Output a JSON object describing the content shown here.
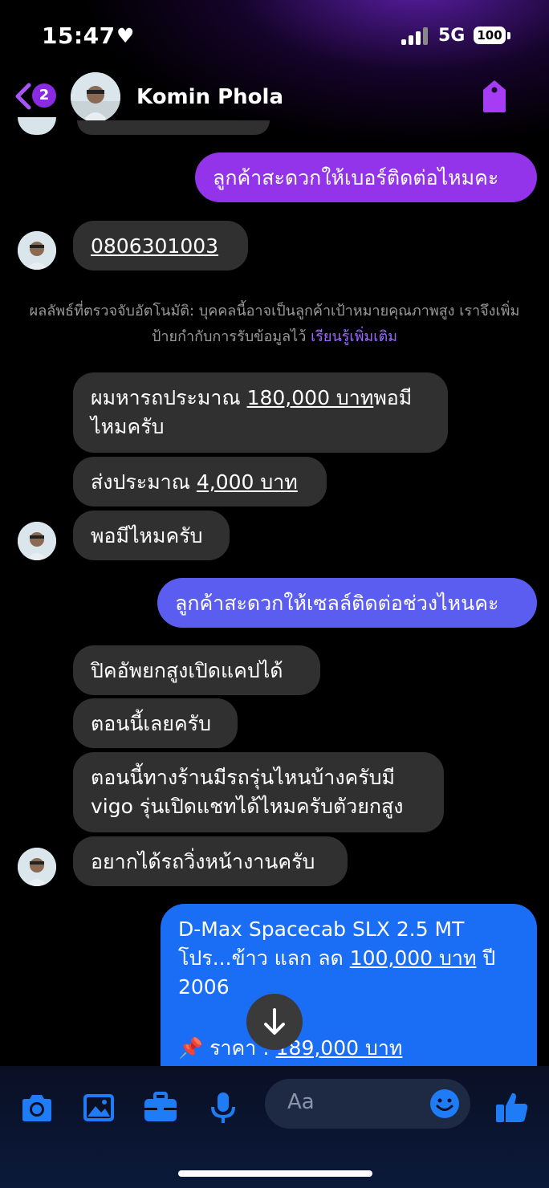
{
  "status_bar": {
    "time": "15:47",
    "network": "5G",
    "battery": "100"
  },
  "header": {
    "unread_count": "2",
    "contact_name": "Komin Phola"
  },
  "messages": {
    "out1": "ลูกค้าสะดวกให้เบอร์ติดต่อไหมคะ",
    "in_phone": "0806301003",
    "system_note": "ผลลัพธ์ที่ตรวจจับอัตโนมัติ: บุคคลนี้อาจเป็นลูกค้าเป้าหมายคุณภาพสูง เราจึงเพิ่มป้ายกำกับการรับข้อมูลไว้",
    "system_link": "เรียนรู้เพิ่มเติม",
    "in2_prefix": "ผมหารถประมาณ ",
    "in2_amount": "180,000 บาท",
    "in2_suffix": "พอมีไหมครับ",
    "in3_prefix": "ส่งประมาณ ",
    "in3_amount": "4,000 บาท",
    "in4": "พอมีไหมครับ",
    "out2": "ลูกค้าสะดวกให้เซลล์ติดต่อช่วงไหนคะ",
    "in5": "ปิคอัพยกสูงเปิดแคปได้",
    "in6": "ตอนนี้เลยครับ",
    "in7": "ตอนนี้ทางร้านมีรถรุ่นไหนบ้างครับมี vigo รุ่นเปิดแชทได้ไหมครับตัวยกสูง",
    "in8": "อยากได้รถวิ่งหน้างานครับ",
    "out3_line1": "D-Max Spacecab SLX 2.5 MT",
    "out3_prefix": "โปร...ข้าว แลก ลด ",
    "out3_amount": "100,000 บาท",
    "out3_suffix": " ปี 2006",
    "out3_price_label": "ราคา : ",
    "out3_price": "189,000 บาท"
  },
  "composer": {
    "placeholder": "Aa"
  },
  "colors": {
    "accent_purple": "#8a2be2",
    "bubble_in": "#303030",
    "bubble_out_purple": "#9333ea",
    "bubble_out_indigo": "#5b5cf0",
    "bubble_out_blue": "#1a6df5",
    "icon_blue": "#1e7cf7"
  },
  "icons": [
    "back-chevron-icon",
    "tag-icon",
    "scroll-down-icon",
    "camera-icon",
    "gallery-icon",
    "briefcase-icon",
    "microphone-icon",
    "emoji-icon",
    "thumbs-up-icon",
    "pin-icon"
  ]
}
